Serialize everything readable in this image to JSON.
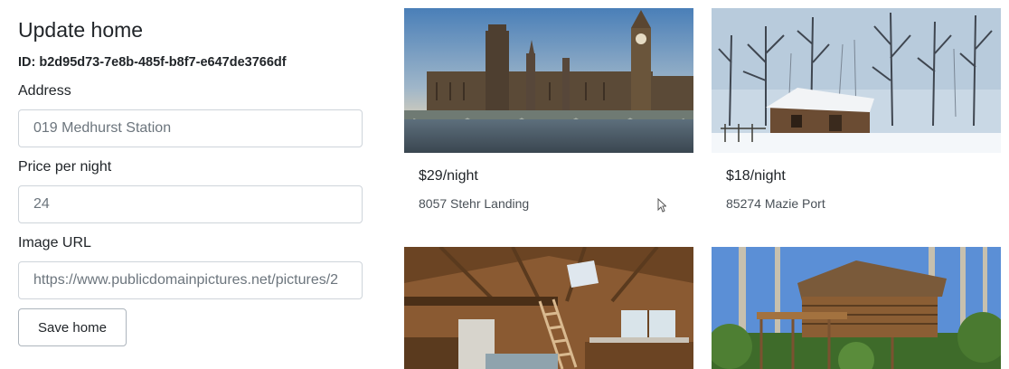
{
  "form": {
    "title": "Update home",
    "id_text": "ID: b2d95d73-7e8b-485f-b8f7-e647de3766df",
    "address_label": "Address",
    "address_value": "019 Medhurst Station",
    "price_label": "Price per night",
    "price_value": "24",
    "image_label": "Image URL",
    "image_value": "https://www.publicdomainpictures.net/pictures/2",
    "save_label": "Save home"
  },
  "listings": [
    {
      "price": "$29/night",
      "address": "8057 Stehr Landing",
      "photo": "london-parliament-photo"
    },
    {
      "price": "$18/night",
      "address": "85274 Mazie Port",
      "photo": "snowy-cabin-photo"
    },
    {
      "price": "",
      "address": "",
      "photo": "cabin-interior-photo"
    },
    {
      "price": "",
      "address": "",
      "photo": "forest-treehouse-photo"
    }
  ],
  "icons": {
    "cursor": "pointer-cursor-icon"
  }
}
